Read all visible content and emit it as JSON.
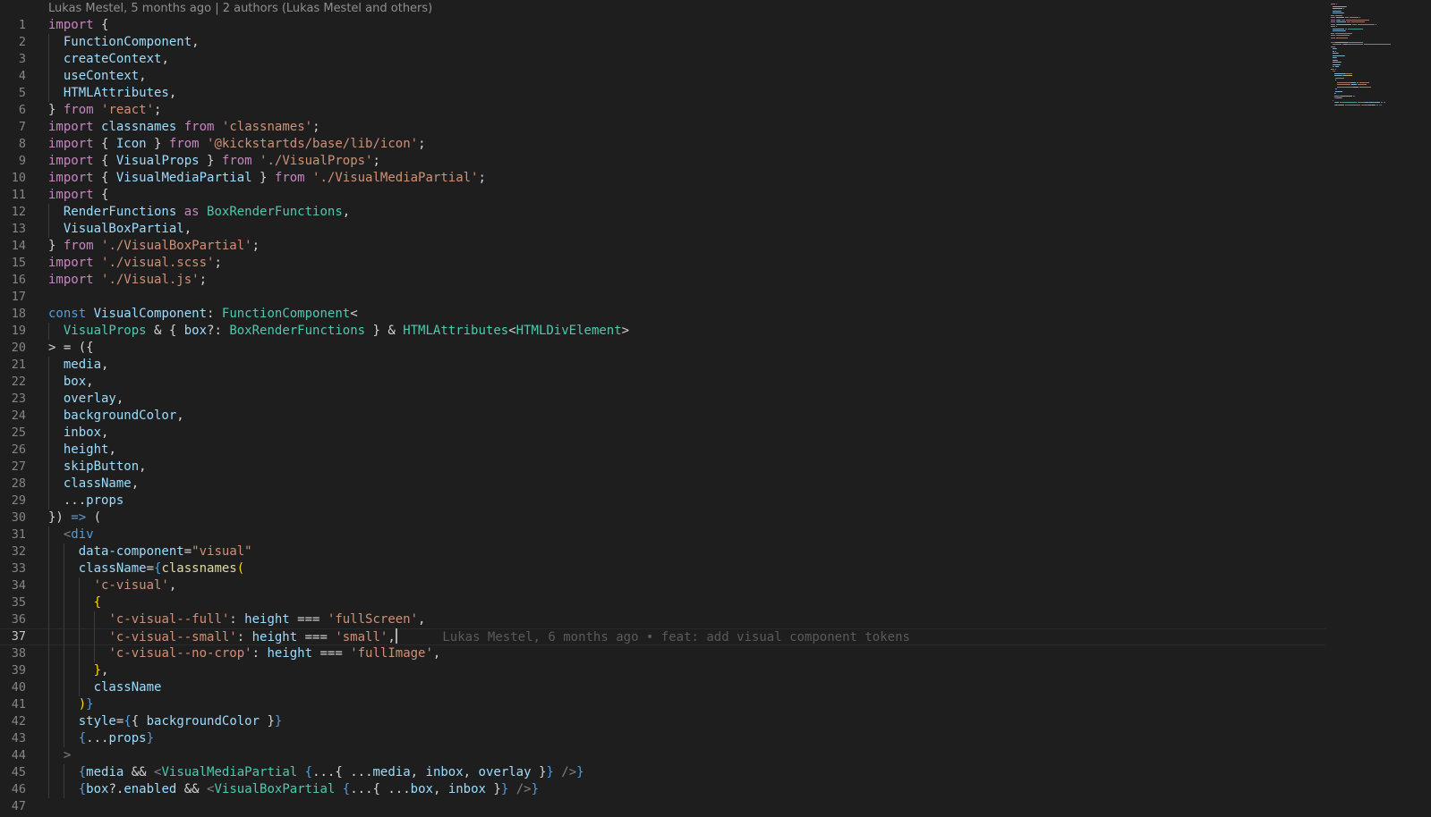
{
  "blame_header": "Lukas Mestel, 5 months ago | 2 authors (Lukas Mestel and others)",
  "current_line": 37,
  "inline_blame": "Lukas Mestel, 6 months ago • feat: add visual component tokens",
  "colors": {
    "background": "#1e1e1e",
    "keyword": "#c586c0",
    "string": "#ce9178",
    "variable": "#9cdcfe",
    "type": "#4ec9b0",
    "function": "#dcdcaa",
    "storage": "#569cd6",
    "tag_punct": "#808080",
    "bracket": "#ffd700"
  },
  "lines": [
    [
      [
        "k",
        "import"
      ],
      [
        "p",
        " {"
      ]
    ],
    [
      [
        "p",
        "  "
      ],
      [
        "v",
        "FunctionComponent"
      ],
      [
        "p",
        ","
      ]
    ],
    [
      [
        "p",
        "  "
      ],
      [
        "v",
        "createContext"
      ],
      [
        "p",
        ","
      ]
    ],
    [
      [
        "p",
        "  "
      ],
      [
        "v",
        "useContext"
      ],
      [
        "p",
        ","
      ]
    ],
    [
      [
        "p",
        "  "
      ],
      [
        "v",
        "HTMLAttributes"
      ],
      [
        "p",
        ","
      ]
    ],
    [
      [
        "p",
        "} "
      ],
      [
        "k",
        "from"
      ],
      [
        "p",
        " "
      ],
      [
        "s",
        "'react'"
      ],
      [
        "p",
        ";"
      ]
    ],
    [
      [
        "k",
        "import"
      ],
      [
        "p",
        " "
      ],
      [
        "v",
        "classnames"
      ],
      [
        "p",
        " "
      ],
      [
        "k",
        "from"
      ],
      [
        "p",
        " "
      ],
      [
        "s",
        "'classnames'"
      ],
      [
        "p",
        ";"
      ]
    ],
    [
      [
        "k",
        "import"
      ],
      [
        "p",
        " { "
      ],
      [
        "v",
        "Icon"
      ],
      [
        "p",
        " } "
      ],
      [
        "k",
        "from"
      ],
      [
        "p",
        " "
      ],
      [
        "s",
        "'@kickstartds/base/lib/icon'"
      ],
      [
        "p",
        ";"
      ]
    ],
    [
      [
        "k",
        "import"
      ],
      [
        "p",
        " { "
      ],
      [
        "v",
        "VisualProps"
      ],
      [
        "p",
        " } "
      ],
      [
        "k",
        "from"
      ],
      [
        "p",
        " "
      ],
      [
        "s",
        "'./VisualProps'"
      ],
      [
        "p",
        ";"
      ]
    ],
    [
      [
        "k",
        "import"
      ],
      [
        "p",
        " { "
      ],
      [
        "v",
        "VisualMediaPartial"
      ],
      [
        "p",
        " } "
      ],
      [
        "k",
        "from"
      ],
      [
        "p",
        " "
      ],
      [
        "s",
        "'./VisualMediaPartial'"
      ],
      [
        "p",
        ";"
      ]
    ],
    [
      [
        "k",
        "import"
      ],
      [
        "p",
        " {"
      ]
    ],
    [
      [
        "p",
        "  "
      ],
      [
        "v",
        "RenderFunctions"
      ],
      [
        "p",
        " "
      ],
      [
        "k",
        "as"
      ],
      [
        "p",
        " "
      ],
      [
        "t",
        "BoxRenderFunctions"
      ],
      [
        "p",
        ","
      ]
    ],
    [
      [
        "p",
        "  "
      ],
      [
        "v",
        "VisualBoxPartial"
      ],
      [
        "p",
        ","
      ]
    ],
    [
      [
        "p",
        "} "
      ],
      [
        "k",
        "from"
      ],
      [
        "p",
        " "
      ],
      [
        "s",
        "'./VisualBoxPartial'"
      ],
      [
        "p",
        ";"
      ]
    ],
    [
      [
        "k",
        "import"
      ],
      [
        "p",
        " "
      ],
      [
        "s",
        "'./visual.scss'"
      ],
      [
        "p",
        ";"
      ]
    ],
    [
      [
        "k",
        "import"
      ],
      [
        "p",
        " "
      ],
      [
        "s",
        "'./Visual.js'"
      ],
      [
        "p",
        ";"
      ]
    ],
    [],
    [
      [
        "b",
        "const"
      ],
      [
        "p",
        " "
      ],
      [
        "v",
        "VisualComponent"
      ],
      [
        "p",
        ": "
      ],
      [
        "t",
        "FunctionComponent"
      ],
      [
        "p",
        "<"
      ]
    ],
    [
      [
        "p",
        "  "
      ],
      [
        "t",
        "VisualProps"
      ],
      [
        "p",
        " & { "
      ],
      [
        "v",
        "box"
      ],
      [
        "p",
        "?: "
      ],
      [
        "t",
        "BoxRenderFunctions"
      ],
      [
        "p",
        " } & "
      ],
      [
        "t",
        "HTMLAttributes"
      ],
      [
        "p",
        "<"
      ],
      [
        "t",
        "HTMLDivElement"
      ],
      [
        "p",
        ">"
      ]
    ],
    [
      [
        "p",
        "> = ({"
      ]
    ],
    [
      [
        "p",
        "  "
      ],
      [
        "v",
        "media"
      ],
      [
        "p",
        ","
      ]
    ],
    [
      [
        "p",
        "  "
      ],
      [
        "v",
        "box"
      ],
      [
        "p",
        ","
      ]
    ],
    [
      [
        "p",
        "  "
      ],
      [
        "v",
        "overlay"
      ],
      [
        "p",
        ","
      ]
    ],
    [
      [
        "p",
        "  "
      ],
      [
        "v",
        "backgroundColor"
      ],
      [
        "p",
        ","
      ]
    ],
    [
      [
        "p",
        "  "
      ],
      [
        "v",
        "inbox"
      ],
      [
        "p",
        ","
      ]
    ],
    [
      [
        "p",
        "  "
      ],
      [
        "v",
        "height"
      ],
      [
        "p",
        ","
      ]
    ],
    [
      [
        "p",
        "  "
      ],
      [
        "v",
        "skipButton"
      ],
      [
        "p",
        ","
      ]
    ],
    [
      [
        "p",
        "  "
      ],
      [
        "v",
        "className"
      ],
      [
        "p",
        ","
      ]
    ],
    [
      [
        "p",
        "  ..."
      ],
      [
        "v",
        "props"
      ]
    ],
    [
      [
        "p",
        "}) "
      ],
      [
        "b",
        "=>"
      ],
      [
        "p",
        " ("
      ]
    ],
    [
      [
        "p",
        "  "
      ],
      [
        "g",
        "<"
      ],
      [
        "b",
        "div"
      ]
    ],
    [
      [
        "p",
        "    "
      ],
      [
        "v",
        "data-component"
      ],
      [
        "p",
        "="
      ],
      [
        "s",
        "\"visual\""
      ]
    ],
    [
      [
        "p",
        "    "
      ],
      [
        "v",
        "className"
      ],
      [
        "p",
        "="
      ],
      [
        "b",
        "{"
      ],
      [
        "f",
        "classnames"
      ],
      [
        "y",
        "("
      ]
    ],
    [
      [
        "p",
        "      "
      ],
      [
        "s",
        "'c-visual'"
      ],
      [
        "p",
        ","
      ]
    ],
    [
      [
        "p",
        "      "
      ],
      [
        "y",
        "{"
      ]
    ],
    [
      [
        "p",
        "        "
      ],
      [
        "s",
        "'c-visual--full'"
      ],
      [
        "p",
        ": "
      ],
      [
        "v",
        "height"
      ],
      [
        "p",
        " === "
      ],
      [
        "s",
        "'fullScreen'"
      ],
      [
        "p",
        ","
      ]
    ],
    [
      [
        "p",
        "        "
      ],
      [
        "s",
        "'c-visual--small'"
      ],
      [
        "p",
        ": "
      ],
      [
        "v",
        "height"
      ],
      [
        "p",
        " === "
      ],
      [
        "s",
        "'small'"
      ],
      [
        "p",
        ","
      ]
    ],
    [
      [
        "p",
        "        "
      ],
      [
        "s",
        "'c-visual--no-crop'"
      ],
      [
        "p",
        ": "
      ],
      [
        "v",
        "height"
      ],
      [
        "p",
        " === "
      ],
      [
        "s",
        "'fullImage'"
      ],
      [
        "p",
        ","
      ]
    ],
    [
      [
        "p",
        "      "
      ],
      [
        "y",
        "}"
      ],
      [
        "p",
        ","
      ]
    ],
    [
      [
        "p",
        "      "
      ],
      [
        "v",
        "className"
      ]
    ],
    [
      [
        "p",
        "    "
      ],
      [
        "y",
        ")"
      ],
      [
        "b",
        "}"
      ]
    ],
    [
      [
        "p",
        "    "
      ],
      [
        "v",
        "style"
      ],
      [
        "p",
        "="
      ],
      [
        "b",
        "{"
      ],
      [
        "p",
        "{ "
      ],
      [
        "v",
        "backgroundColor"
      ],
      [
        "p",
        " }"
      ],
      [
        "b",
        "}"
      ]
    ],
    [
      [
        "p",
        "    "
      ],
      [
        "b",
        "{"
      ],
      [
        "p",
        "..."
      ],
      [
        "v",
        "props"
      ],
      [
        "b",
        "}"
      ]
    ],
    [
      [
        "p",
        "  "
      ],
      [
        "g",
        ">"
      ]
    ],
    [
      [
        "p",
        "    "
      ],
      [
        "b",
        "{"
      ],
      [
        "v",
        "media"
      ],
      [
        "p",
        " && "
      ],
      [
        "g",
        "<"
      ],
      [
        "t",
        "VisualMediaPartial"
      ],
      [
        "p",
        " "
      ],
      [
        "b",
        "{"
      ],
      [
        "p",
        "...{ ..."
      ],
      [
        "v",
        "media"
      ],
      [
        "p",
        ", "
      ],
      [
        "v",
        "inbox"
      ],
      [
        "p",
        ", "
      ],
      [
        "v",
        "overlay"
      ],
      [
        "p",
        " }"
      ],
      [
        "b",
        "}"
      ],
      [
        "p",
        " "
      ],
      [
        "g",
        "/>"
      ],
      [
        "b",
        "}"
      ]
    ],
    [
      [
        "p",
        "    "
      ],
      [
        "b",
        "{"
      ],
      [
        "v",
        "box"
      ],
      [
        "p",
        "?."
      ],
      [
        "v",
        "enabled"
      ],
      [
        "p",
        " && "
      ],
      [
        "g",
        "<"
      ],
      [
        "t",
        "VisualBoxPartial"
      ],
      [
        "p",
        " "
      ],
      [
        "b",
        "{"
      ],
      [
        "p",
        "...{ ..."
      ],
      [
        "v",
        "box"
      ],
      [
        "p",
        ", "
      ],
      [
        "v",
        "inbox"
      ],
      [
        "p",
        " }"
      ],
      [
        "b",
        "}"
      ],
      [
        "p",
        " "
      ],
      [
        "g",
        "/>"
      ],
      [
        "b",
        "}"
      ]
    ],
    []
  ]
}
